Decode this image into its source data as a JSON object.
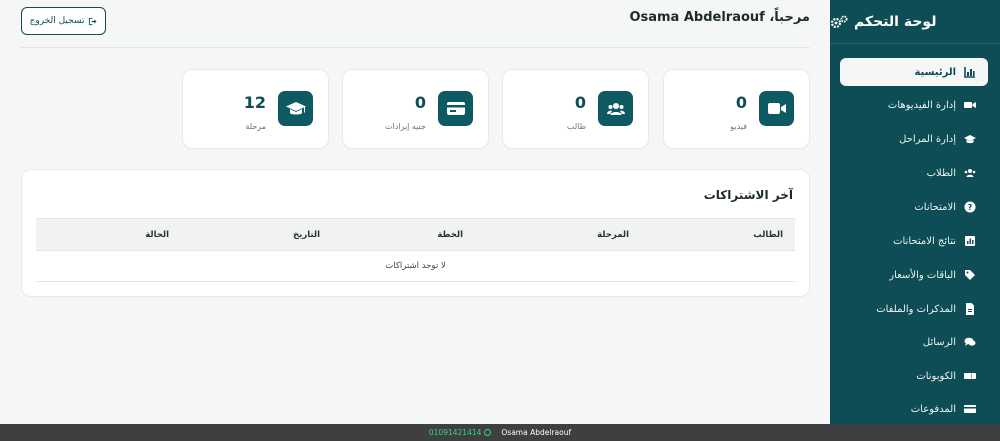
{
  "sidebar": {
    "title": "لوحة التحكم",
    "title_icon": "gears-icon",
    "items": [
      {
        "label": "الرئيسية",
        "icon": "chart-icon",
        "active": true
      },
      {
        "label": "إدارة الفيديوهات",
        "icon": "video-icon",
        "active": false
      },
      {
        "label": "إدارة المراحل",
        "icon": "graduation-cap-icon",
        "active": false
      },
      {
        "label": "الطلاب",
        "icon": "users-icon",
        "active": false
      },
      {
        "label": "الامتحانات",
        "icon": "question-circle-icon",
        "active": false
      },
      {
        "label": "نتائج الامتحانات",
        "icon": "poll-icon",
        "active": false
      },
      {
        "label": "الباقات والأسعار",
        "icon": "tags-icon",
        "active": false
      },
      {
        "label": "المذكرات والملفات",
        "icon": "file-pdf-icon",
        "active": false
      },
      {
        "label": "الرسائل",
        "icon": "comments-icon",
        "active": false
      },
      {
        "label": "الكوبونات",
        "icon": "ticket-icon",
        "active": false
      },
      {
        "label": "المدفوعات",
        "icon": "credit-card-icon",
        "active": false
      }
    ]
  },
  "header": {
    "welcome": "مرحباً، Osama Abdelraouf",
    "logout_label": "تسجيل الخروج",
    "logout_icon": "sign-out-icon"
  },
  "stats": [
    {
      "value": "0",
      "label": "فيديو",
      "icon": "video-icon"
    },
    {
      "value": "0",
      "label": "طالب",
      "icon": "users-icon"
    },
    {
      "value": "0",
      "label": "جنيه إيرادات",
      "icon": "money-card-icon"
    },
    {
      "value": "12",
      "label": "مرحلة",
      "icon": "graduation-cap-icon"
    }
  ],
  "subscriptions": {
    "title": "آخر الاشتراكات",
    "columns": [
      "الطالب",
      "المرحلة",
      "الخطة",
      "التاريخ",
      "الحالة"
    ],
    "empty_text": "لا توجد اشتراكات"
  },
  "footer": {
    "name": "Osama Abdelraouf",
    "phone": "01091421414"
  },
  "colors": {
    "primary": "#0e4d55",
    "accent_green": "#37d67a",
    "background": "#f5f6f6"
  }
}
